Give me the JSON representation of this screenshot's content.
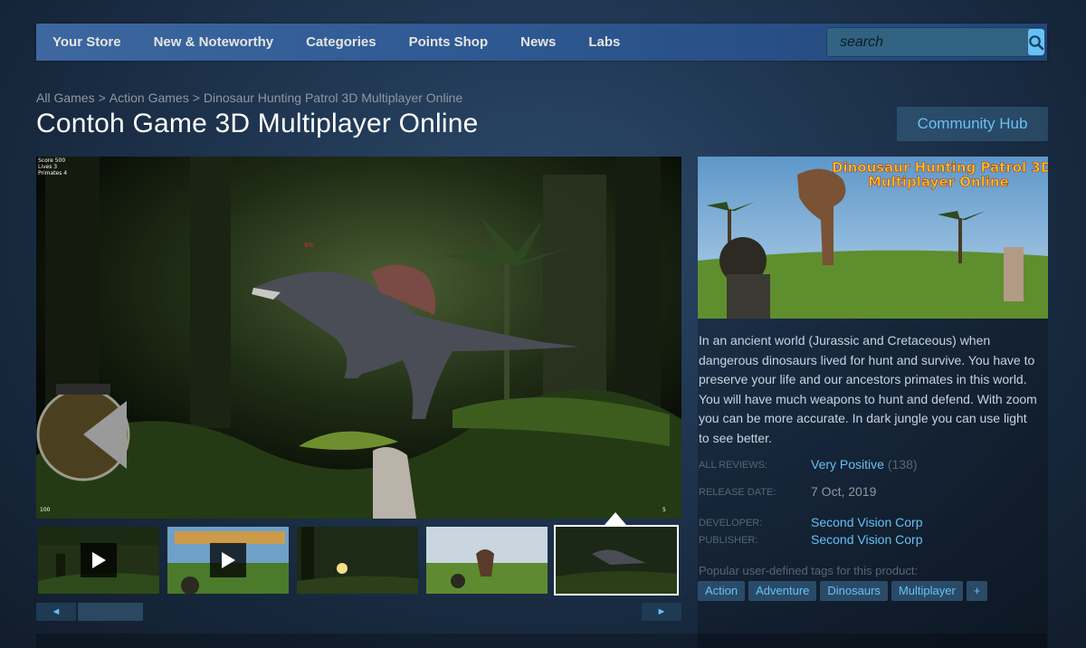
{
  "nav": {
    "items": [
      {
        "label": "Your Store"
      },
      {
        "label": "New & Noteworthy"
      },
      {
        "label": "Categories"
      },
      {
        "label": "Points Shop"
      },
      {
        "label": "News"
      },
      {
        "label": "Labs"
      }
    ],
    "search_placeholder": "search"
  },
  "breadcrumb": [
    "All Games",
    "Action Games",
    "Dinosaur Hunting Patrol 3D Multiplayer Online"
  ],
  "title": "Contoh Game 3D Multiplayer Online",
  "community_hub": "Community Hub",
  "screenshot_hud": {
    "score": "Score 500",
    "lives": "Lives 3",
    "primates": "Primates 4",
    "health": "100",
    "ammo": "5",
    "pct": "8%"
  },
  "capsule": {
    "line1": "Dinousaur Hunting Patrol 3D",
    "line2": "Multiplayer Online"
  },
  "description": "In an ancient world (Jurassic and Cretaceous) when dangerous dinosaurs lived for hunt and survive. You have to preserve your life and our ancestors primates in this world. You will have much weapons to hunt and defend. With zoom you can be more accurate. In dark jungle you can use light to see better.",
  "reviews": {
    "label": "ALL REVIEWS:",
    "value": "Very Positive",
    "count": "(138)"
  },
  "release": {
    "label": "RELEASE DATE:",
    "value": "7 Oct, 2019"
  },
  "developer": {
    "label": "DEVELOPER:",
    "value": "Second Vision Corp"
  },
  "publisher": {
    "label": "PUBLISHER:",
    "value": "Second Vision Corp"
  },
  "tags_label": "Popular user-defined tags for this product:",
  "tags": [
    "Action",
    "Adventure",
    "Dinosaurs",
    "Multiplayer",
    "+"
  ],
  "colors": {
    "accent": "#67c1f5",
    "nav": "#2f5a93",
    "text": "#c6d4df",
    "muted": "#556772"
  }
}
